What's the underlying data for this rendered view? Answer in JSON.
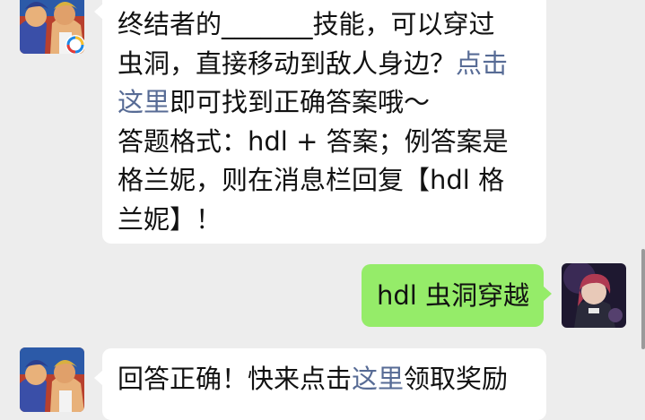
{
  "messages": [
    {
      "sender": "official",
      "lines": [
        [
          {
            "t": "终结者的_______技能，可以穿过"
          }
        ],
        [
          {
            "t": "虫洞，直接移动到敌人身边？"
          },
          {
            "t": "点击",
            "link": true
          }
        ],
        [
          {
            "t": "这里",
            "link": true
          },
          {
            "t": "即可找到正确答案哦～"
          }
        ],
        [
          {
            "t": "答题格式：hdl + 答案；例答案是"
          }
        ],
        [
          {
            "t": "格兰妮，则在消息栏回复【hdl 格"
          }
        ],
        [
          {
            "t": "兰妮】！"
          }
        ]
      ]
    },
    {
      "sender": "me",
      "lines": [
        [
          {
            "t": "hdl 虫洞穿越"
          }
        ]
      ]
    },
    {
      "sender": "official",
      "lines": [
        [
          {
            "t": "回答正确！快来点击"
          },
          {
            "t": "这里",
            "link": true
          },
          {
            "t": "领取奖励"
          }
        ]
      ]
    }
  ],
  "colors": {
    "background": "#ededed",
    "bubble_in": "#ffffff",
    "bubble_out": "#95ec69",
    "link": "#576b95",
    "text": "#111111"
  },
  "icons": {
    "official_avatar": "game-character-avatar-icon",
    "official_badge": "game-app-badge-icon",
    "user_avatar": "anime-user-avatar-icon"
  }
}
